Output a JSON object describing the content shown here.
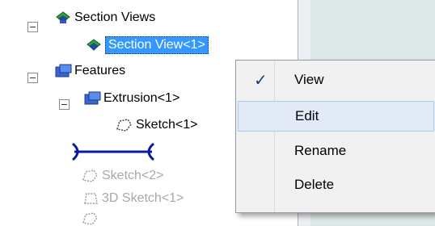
{
  "tree": {
    "section_views": "Section Views",
    "section_view_1": "Section View<1>",
    "features": "Features",
    "extrusion_1": "Extrusion<1>",
    "sketch_1": "Sketch<1>",
    "sketch_2": "Sketch<2>",
    "sketch3d_1": "3D Sketch<1>"
  },
  "menu": {
    "items": [
      "View",
      "Edit",
      "Rename",
      "Delete"
    ],
    "checked_item": "View",
    "hover_item": "Edit"
  },
  "colors": {
    "selection": "#3399ff",
    "hover_bg": "#e1eaf6",
    "connector": "#0a1a9e"
  }
}
